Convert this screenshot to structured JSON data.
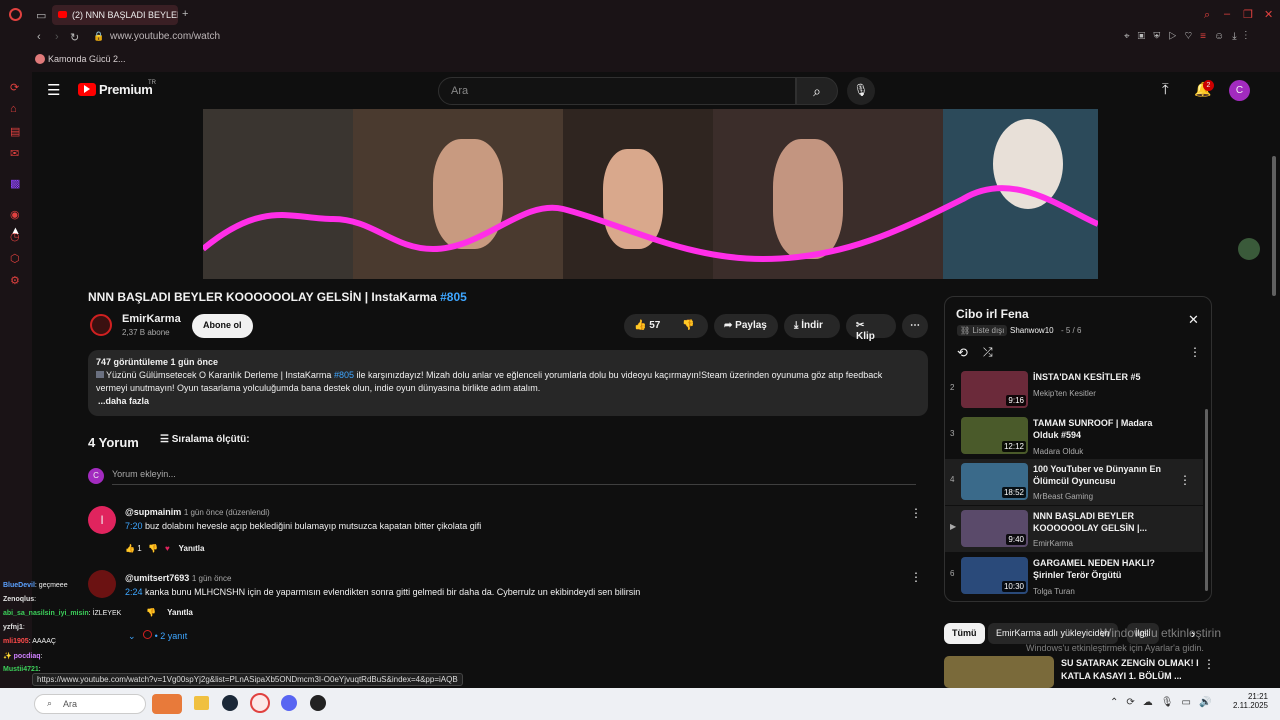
{
  "browser": {
    "tab_title": "(2) NNN BAŞLADI BEYLER",
    "url": "www.youtube.com/watch",
    "bookmark": "Kamonda Gücü 2...",
    "status_url": "https://www.youtube.com/watch?v=1Vg00spYj2g&list=PLnASipaXb5ONDmcm3I-O0eYjvuqtRdBuS&index=4&pp=iAQB"
  },
  "header": {
    "logo_text": "Premium",
    "logo_region": "TR",
    "search_placeholder": "Ara",
    "notification_count": "2",
    "avatar_letter": "C"
  },
  "video": {
    "title": "NNN BAŞLADI BEYLER KOOOOOOLAY GELSİN | InstaKarma",
    "hashtag": "#805",
    "channel": "EmirKarma",
    "subscribers": "2,37 B abone",
    "subscribe_label": "Abone ol",
    "likes": "57",
    "share_label": "Paylaş",
    "download_label": "İndir",
    "clip_label": "Klip",
    "views_line": "747 görüntüleme  1 gün önce",
    "desc_line1_a": "Yüzünü Gülümsetecek O Karanlık Derleme | InstaKarma ",
    "desc_line1_tag": "#805",
    "desc_line1_b": " ile karşınızdayız!  Mizah dolu anlar ve eğlenceli yorumlarla dolu bu videoyu kaçırmayın!Steam üzerinden oyunuma göz atıp feedback",
    "desc_line2": "vermeyi unutmayın! Oyun tasarlama yolculuğumda bana destek olun, indie oyun dünyasına birlikte adım atalım.",
    "more": "...daha fazla"
  },
  "comments_section": {
    "count": "4 Yorum",
    "sort_label": "Sıralama ölçütü:",
    "add_placeholder": "Yorum ekleyin...",
    "my_avatar": "C",
    "comments": [
      {
        "author": "@supmainim",
        "time": "1 gün önce (düzenlendi)",
        "timestamp": "7:20",
        "text": " buz dolabını hevesle açıp beklediğini bulamayıp mutsuzca kapatan bitter çikolata gifi",
        "likes": "1",
        "reply": "Yanıtla",
        "avatar": "I"
      },
      {
        "author": "@umitsert7693",
        "time": "1 gün önce",
        "timestamp": "2:24",
        "text": " kanka bunu MLHCNSHN için de yaparmısın evlendikten sonra gitti gelmedi bir daha da. Cyberrulz un ekibindeydi sen bilirsin",
        "likes": "",
        "reply": "Yanıtla",
        "replies": "• 2 yanıt"
      }
    ]
  },
  "playlist": {
    "title": "Cibo irl Fena",
    "privacy": "Liste dışı",
    "owner": "Shanwow10",
    "position": "- 5 / 6",
    "items": [
      {
        "num": "2",
        "title": "İNSTA'DAN KESİTLER #5",
        "channel": "Mekip'ten Kesitler",
        "duration": "9:16",
        "color": "#6b2a3a"
      },
      {
        "num": "3",
        "title": "TAMAM SUNROOF | Madara Olduk #594",
        "channel": "Madara Olduk",
        "duration": "12:12",
        "color": "#4a5a2a"
      },
      {
        "num": "4",
        "title": "100 YouTuber ve Dünyanın En Ölümcül Oyuncusu",
        "channel": "MrBeast Gaming",
        "duration": "18:52",
        "color": "#3a6a8a"
      },
      {
        "num": "▶",
        "title": "NNN BAŞLADI BEYLER KOOOOOOLAY GELSİN |...",
        "channel": "EmirKarma",
        "duration": "9:40",
        "color": "#5a4a6a"
      },
      {
        "num": "6",
        "title": "GARGAMEL NEDEN HAKLI? Şirinler Terör Örgütü",
        "channel": "Tolga Turan",
        "duration": "10:30",
        "color": "#2a4a7a"
      }
    ]
  },
  "chips": [
    "Tümü",
    "EmirKarma adlı yükleyiciden",
    "İlgili"
  ],
  "next_video": {
    "title_line1": "SU SATARAK ZENGİN OLMAK! I",
    "title_line2": "KATLA KASAYI 1. BÖLÜM ..."
  },
  "watermark": {
    "line1": "Windows'u etkinleştirin",
    "line2": "Windows'u etkinleştirmek için Ayarlar'a gidin."
  },
  "stream_chat": [
    {
      "user": "BlueDevil",
      "msg": ": geçmeee",
      "color": "#5aa0ff"
    },
    {
      "user": "Zenoqlus",
      "msg": ":",
      "color": "#e0e0e0"
    },
    {
      "user": "abi_sa_nasilsin_iyi_misin",
      "msg": ": İZLEYEK",
      "color": "#3ccf5a"
    },
    {
      "user": "yzfnj1",
      "msg": ":",
      "color": "#e0e0e0"
    },
    {
      "user": "mli1905",
      "msg": ": AAAAÇ",
      "color": "#ff4a4a"
    },
    {
      "user": "✨ pocdiaq",
      "msg": ":",
      "color": "#d080ff"
    },
    {
      "user": "Mustii4721",
      "msg": ":",
      "color": "#3ccf5a"
    }
  ],
  "taskbar": {
    "search": "Ara",
    "time": "21:21",
    "date": "2.11.2025"
  }
}
